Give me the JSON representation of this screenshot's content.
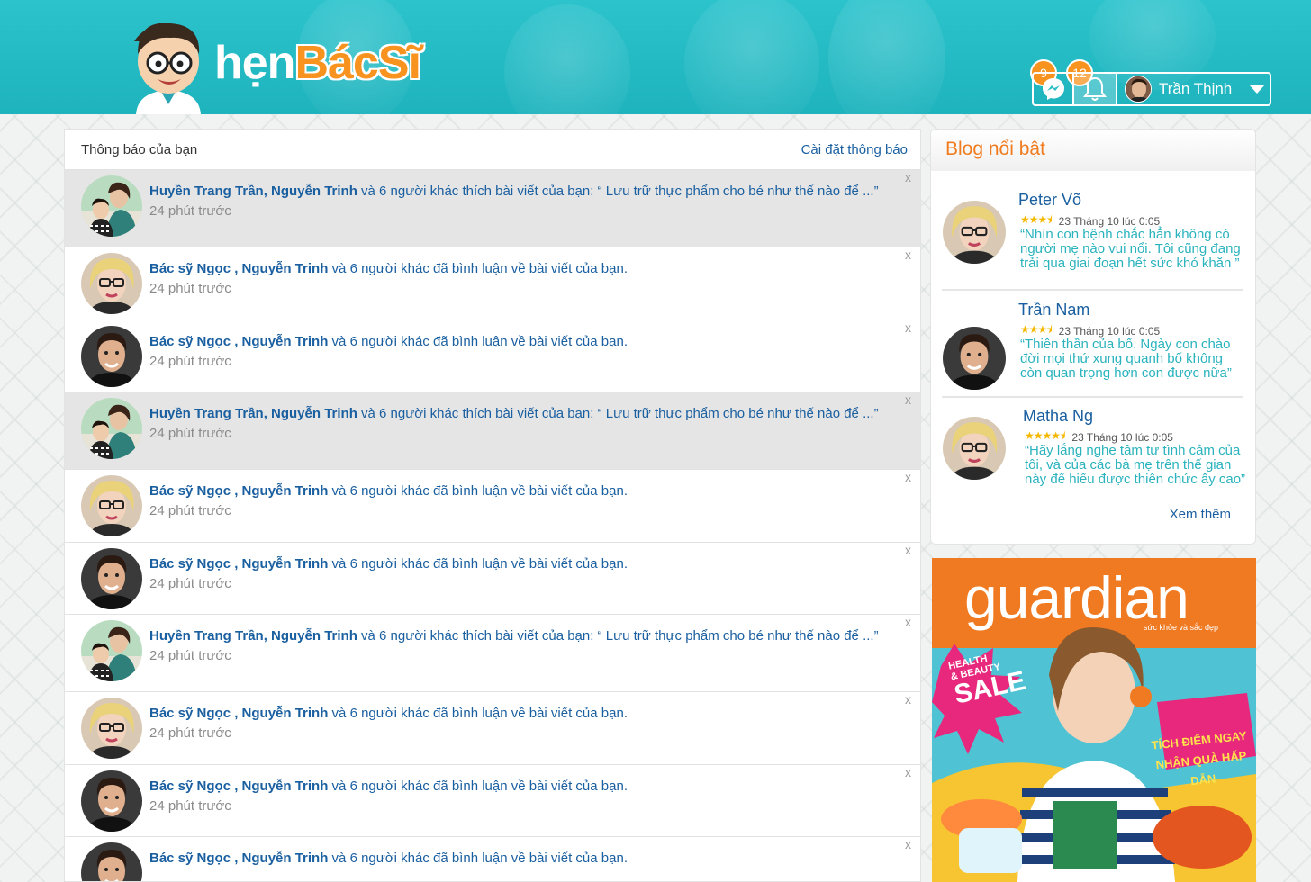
{
  "header": {
    "logo_hen": "hẹn",
    "logo_bacsi": "BácSĩ",
    "messages_count": "9",
    "notifications_count": "12",
    "user_name": "Trần Thịnh"
  },
  "notifications": {
    "title": "Thông báo của bạn",
    "settings_link": "Cài đặt thông báo",
    "close_symbol": "x",
    "items": [
      {
        "type": "like",
        "names": "Huyền Trang Trần, Nguyễn Trinh",
        "rest": " và 6 người khác thích bài viết của bạn: “ Lưu trữ thực phẩm cho bé như thế nào để ...”",
        "time": "24 phút trước",
        "avatar": "mother-child"
      },
      {
        "type": "comment",
        "names": "Bác sỹ Ngọc , Nguyễn Trinh",
        "rest": " và 6 người khác đã bình luận về bài viết của bạn.",
        "time": "24 phút trước",
        "avatar": "blonde-woman"
      },
      {
        "type": "comment",
        "names": "Bác sỹ Ngọc , Nguyễn Trinh",
        "rest": " và 6 người khác đã bình luận về bài viết của bạn.",
        "time": "24 phút trước",
        "avatar": "dark-hair-man"
      },
      {
        "type": "like",
        "names": "Huyền Trang Trần, Nguyễn Trinh",
        "rest": " và 6 người khác thích bài viết của bạn: “ Lưu trữ thực phẩm cho bé như thế nào để ...”",
        "time": "24 phút trước",
        "avatar": "mother-child"
      },
      {
        "type": "comment",
        "names": "Bác sỹ Ngọc , Nguyễn Trinh",
        "rest": " và 6 người khác đã bình luận về bài viết của bạn.",
        "time": "24 phút trước",
        "avatar": "blonde-woman"
      },
      {
        "type": "comment",
        "names": "Bác sỹ Ngọc , Nguyễn Trinh",
        "rest": " và 6 người khác đã bình luận về bài viết của bạn.",
        "time": "24 phút trước",
        "avatar": "dark-hair-man"
      },
      {
        "type": "like",
        "names": "Huyền Trang Trần, Nguyễn Trinh",
        "rest": " và 6 người khác thích bài viết của bạn: “ Lưu trữ thực phẩm cho bé như thế nào để ...”",
        "time": "24 phút trước",
        "avatar": "mother-child"
      },
      {
        "type": "comment",
        "names": "Bác sỹ Ngọc , Nguyễn Trinh",
        "rest": " và 6 người khác đã bình luận về bài viết của bạn.",
        "time": "24 phút trước",
        "avatar": "blonde-woman"
      },
      {
        "type": "comment",
        "names": "Bác sỹ Ngọc , Nguyễn Trinh",
        "rest": " và 6 người khác đã bình luận về bài viết của bạn.",
        "time": "24 phút trước",
        "avatar": "dark-hair-man"
      },
      {
        "type": "comment",
        "names": "Bác sỹ Ngọc , Nguyễn Trinh",
        "rest": " và 6 người khác đã bình luận về bài viết của bạn.",
        "time": "",
        "avatar": "dark-hair-man"
      }
    ]
  },
  "blog": {
    "title": "Blog nổi bật",
    "more_link": "Xem thêm",
    "posts": [
      {
        "author": "Peter Võ",
        "rating": 3.5,
        "date": "23 Tháng 10 lúc 0:05",
        "quote": "“Nhìn con bệnh chắc hẳn không có người mẹ nào vui nổi. Tôi cũng đang trải qua giai đoạn hết sức khó khăn ”",
        "avatar": "blonde-woman"
      },
      {
        "author": "Trần Nam",
        "rating": 3.5,
        "date": "23 Tháng 10 lúc 0:05",
        "quote": "“Thiên thần của bố. Ngày con chào đời mọi thứ xung quanh bố không còn quan trọng hơn con được nữa”",
        "avatar": "dark-hair-man"
      },
      {
        "author": "Matha Ng",
        "rating": 4.5,
        "date": "23 Tháng 10 lúc 0:05",
        "quote": "“Hãy lắng nghe tâm tư tình cảm của tôi, và của các bà mẹ trên thế gian này để hiểu được thiên chức ấy cao”",
        "avatar": "blonde-woman"
      }
    ]
  },
  "ad": {
    "brand": "guardian",
    "tagline": "sức khỏe và sắc đẹp",
    "sale_line1": "HEALTH",
    "sale_line2": "& BEAUTY",
    "sale_line3": "SALE",
    "promo_line1": "TÍCH ĐIỂM NGAY",
    "promo_line2": "NHẬN QUÀ HẤP DẪN",
    "colors": {
      "orange": "#f07a22",
      "teal": "#4fc2d4",
      "pink": "#e8287c"
    }
  }
}
